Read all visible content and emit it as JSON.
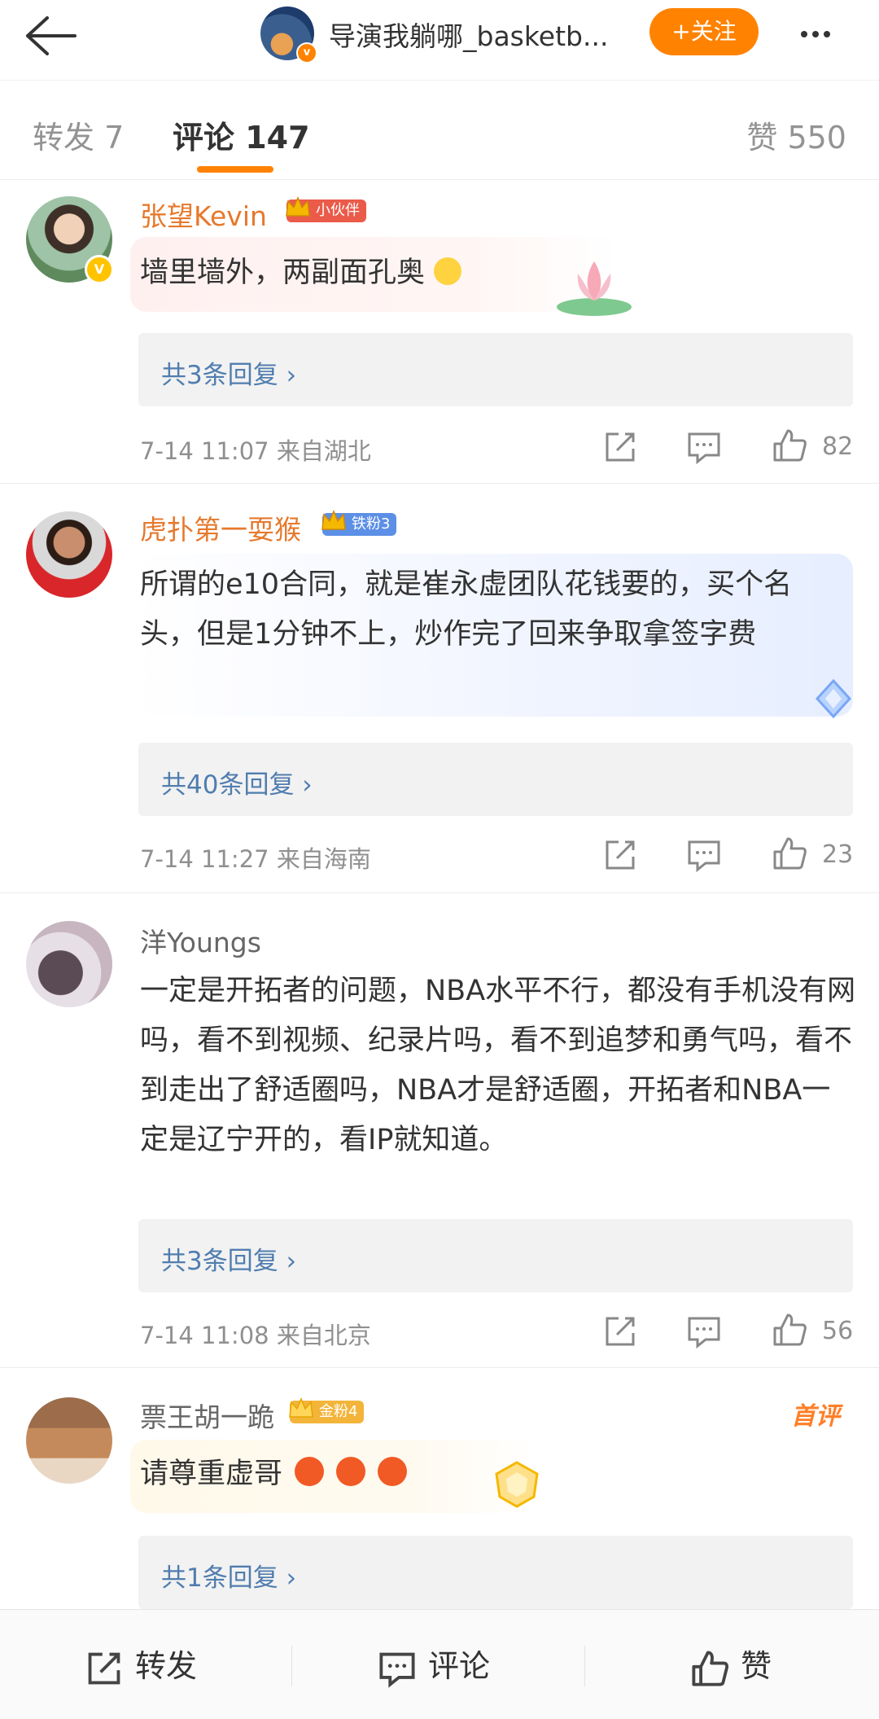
{
  "header": {
    "title": "导演我躺哪_basketb...",
    "follow_label": "+关注"
  },
  "tabs": {
    "repost": "转发 7",
    "comment": "评论 147",
    "like": "赞 550"
  },
  "comments": [
    {
      "username": "张望Kevin",
      "badge": "小伙伴",
      "text": "墙里墙外，两副面孔奥",
      "replies": "共3条回复 ›",
      "meta": "7-14 11:07  来自湖北",
      "likes": "82"
    },
    {
      "username": "虎扑第一耍猴",
      "badge": "铁粉3",
      "text": "所谓的e10合同，就是崔永虚团队花钱要的，买个名头，但是1分钟不上，炒作完了回来争取拿签字费",
      "replies": "共40条回复 ›",
      "meta": "7-14 11:27  来自海南",
      "likes": "23"
    },
    {
      "username": "洋Youngs",
      "text": "一定是开拓者的问题，NBA水平不行，都没有手机没有网吗，看不到视频、纪录片吗，看不到追梦和勇气吗，看不到走出了舒适圈吗，NBA才是舒适圈，开拓者和NBA一定是辽宁开的，看IP就知道。",
      "replies": "共3条回复 ›",
      "meta": "7-14 11:08  来自北京",
      "likes": "56"
    },
    {
      "username": "票王胡一跪",
      "badge": "金粉4",
      "tag": "首评",
      "text": "请尊重虚哥",
      "replies": "共1条回复 ›"
    }
  ],
  "bottom_bar": {
    "repost": "转发",
    "comment": "评论",
    "like": "赞"
  },
  "colors": {
    "accent": "#ff8200",
    "username_orange": "#e6792d",
    "reply_link": "#507daf"
  }
}
